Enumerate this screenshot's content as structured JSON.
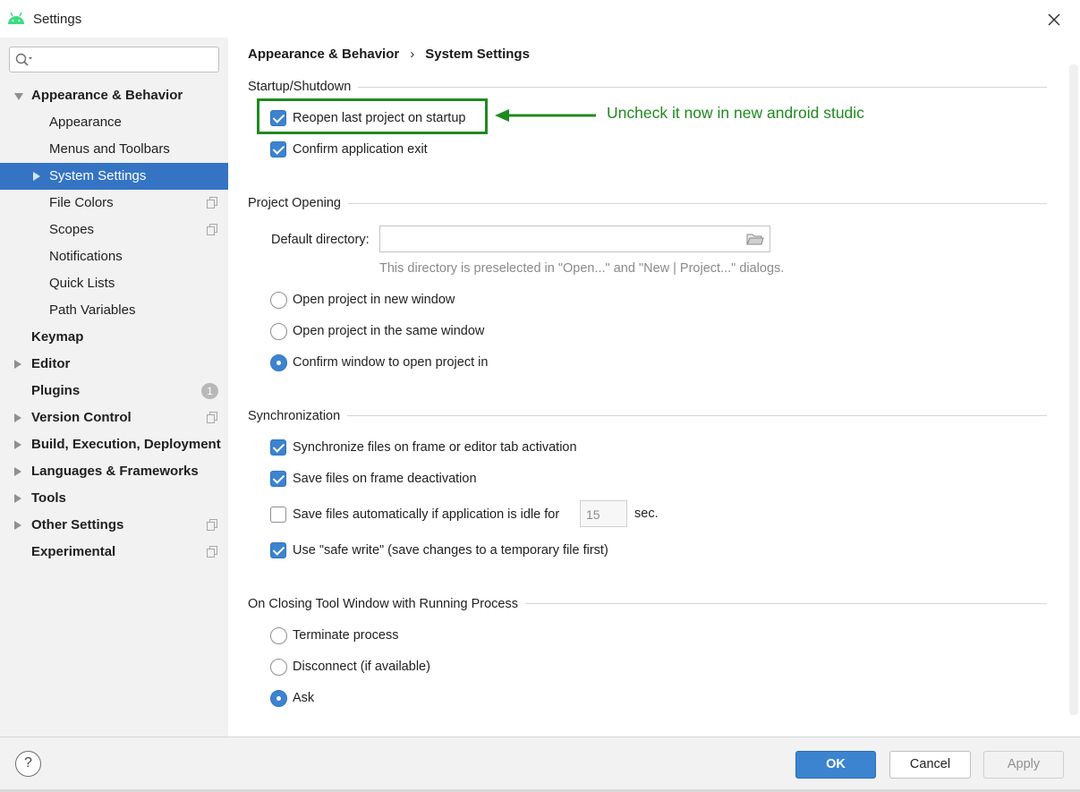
{
  "window": {
    "title": "Settings"
  },
  "sidebar": {
    "search": {
      "value": "",
      "placeholder": ""
    },
    "items": [
      {
        "label": "Appearance & Behavior",
        "expanded": true
      },
      {
        "label": "Appearance"
      },
      {
        "label": "Menus and Toolbars"
      },
      {
        "label": "System Settings",
        "selected": true
      },
      {
        "label": "File Colors"
      },
      {
        "label": "Scopes"
      },
      {
        "label": "Notifications"
      },
      {
        "label": "Quick Lists"
      },
      {
        "label": "Path Variables"
      },
      {
        "label": "Keymap"
      },
      {
        "label": "Editor"
      },
      {
        "label": "Plugins",
        "badge": "1"
      },
      {
        "label": "Version Control"
      },
      {
        "label": "Build, Execution, Deployment"
      },
      {
        "label": "Languages & Frameworks"
      },
      {
        "label": "Tools"
      },
      {
        "label": "Other Settings"
      },
      {
        "label": "Experimental"
      }
    ]
  },
  "breadcrumb": {
    "parent": "Appearance & Behavior",
    "separator": "›",
    "current": "System Settings"
  },
  "startup": {
    "title": "Startup/Shutdown",
    "reopen_last_project": {
      "label": "Reopen last project on startup",
      "checked": true
    },
    "confirm_exit": {
      "label": "Confirm application exit",
      "checked": true
    }
  },
  "annotation": {
    "text": "Uncheck it now in new android studic",
    "color": "#1f8a1f"
  },
  "project_opening": {
    "title": "Project Opening",
    "default_directory_label": "Default directory:",
    "default_directory_value": "",
    "hint": "This directory is preselected in \"Open...\" and \"New | Project...\" dialogs.",
    "options": [
      {
        "label": "Open project in new window",
        "selected": false
      },
      {
        "label": "Open project in the same window",
        "selected": false
      },
      {
        "label": "Confirm window to open project in",
        "selected": true
      }
    ]
  },
  "synchronization": {
    "title": "Synchronization",
    "sync_on_activation": {
      "label": "Synchronize files on frame or editor tab activation",
      "checked": true
    },
    "save_on_deactivation": {
      "label": "Save files on frame deactivation",
      "checked": true
    },
    "save_when_idle": {
      "label": "Save files automatically if application is idle for",
      "checked": false,
      "value": "15",
      "unit": "sec."
    },
    "safe_write": {
      "label": "Use \"safe write\" (save changes to a temporary file first)",
      "checked": true
    }
  },
  "closing_tool_window": {
    "title": "On Closing Tool Window with Running Process",
    "options": [
      {
        "label": "Terminate process",
        "selected": false
      },
      {
        "label": "Disconnect (if available)",
        "selected": false
      },
      {
        "label": "Ask",
        "selected": true
      }
    ]
  },
  "footer": {
    "help": "?",
    "ok": "OK",
    "cancel": "Cancel",
    "apply": "Apply"
  },
  "colors": {
    "accent": "#3c83d0",
    "selection": "#3574c4",
    "annotation": "#1f8a1f"
  }
}
